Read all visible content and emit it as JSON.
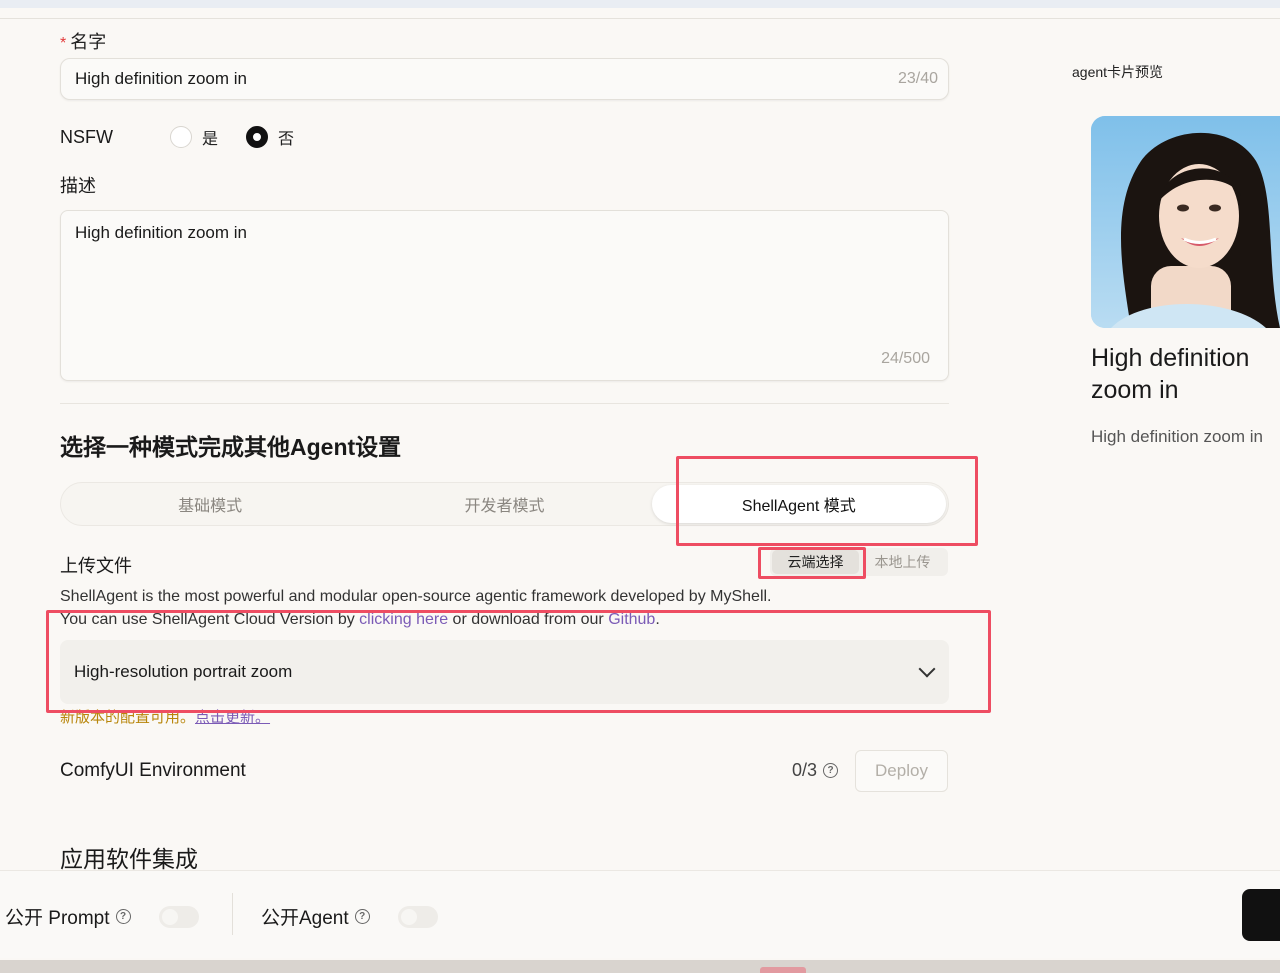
{
  "form": {
    "name_label": "名字",
    "required_mark": "*",
    "name_value": "High definition zoom in",
    "name_count": "23/40",
    "nsfw_label": "NSFW",
    "nsfw_options": [
      "是",
      "否"
    ],
    "nsfw_selected": "否",
    "desc_label": "描述",
    "desc_value": "High definition zoom in",
    "desc_count": "24/500"
  },
  "mode": {
    "title": "选择一种模式完成其他Agent设置",
    "tabs": [
      "基础模式",
      "开发者模式",
      "ShellAgent 模式"
    ],
    "active": "ShellAgent 模式"
  },
  "upload": {
    "label": "上传文件",
    "options": [
      "云端选择",
      "本地上传"
    ],
    "active": "云端选择",
    "info_line1": "ShellAgent is the most powerful and modular open-source agentic framework developed by MyShell.",
    "info_line2_pre": "You can use ShellAgent Cloud Version by ",
    "info_link1": "clicking here",
    "info_line2_mid": " or download from our ",
    "info_link2": "Github",
    "info_line2_end": ".",
    "workflow_value": "High-resolution portrait zoom",
    "update_text": "新版本的配置可用。",
    "update_link": "点击更新。"
  },
  "environment": {
    "label": "ComfyUI Environment",
    "count": "0/3",
    "deploy_label": "Deploy"
  },
  "apps": {
    "label": "应用软件集成"
  },
  "bottom": {
    "public_prompt": "公开 Prompt",
    "public_agent": "公开Agent"
  },
  "preview": {
    "title": "agent卡片预览",
    "card_name": "High definition zoom in",
    "card_desc": "High definition zoom in"
  },
  "colors": {
    "highlight": "#ee4d62",
    "link": "#7b5bb6",
    "warning": "#b8860b"
  }
}
